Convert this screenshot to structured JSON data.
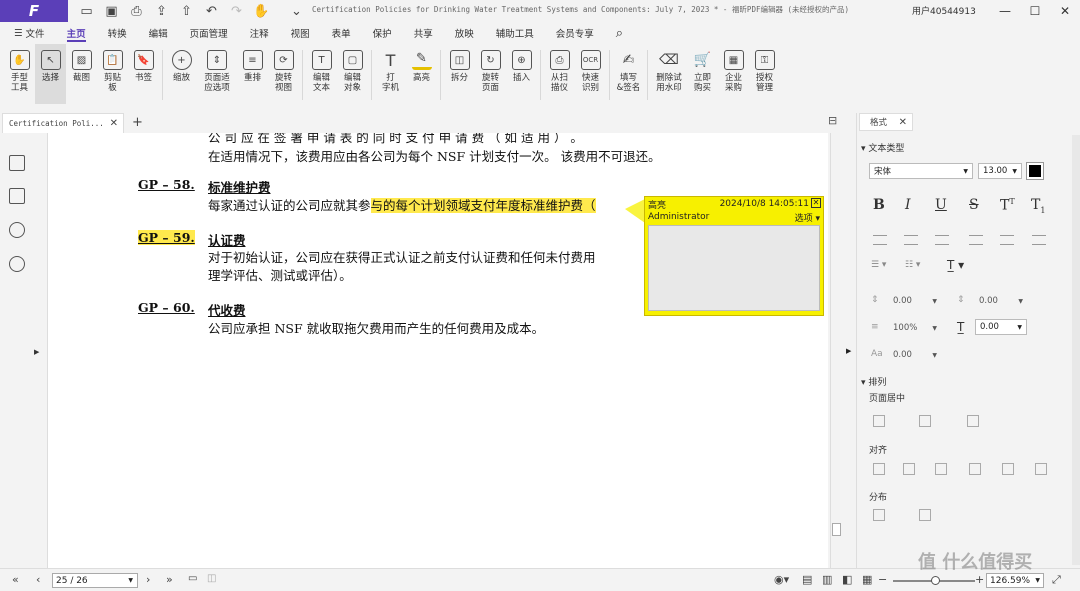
{
  "app": {
    "logo": "F",
    "doc_title": "Certification Policies for Drinking Water Treatment Systems and Components: July 7, 2023 * - 福昕PDF编辑器 (未经授权的产品)",
    "user": "用户40544913"
  },
  "menu": {
    "file": "文件",
    "tabs": [
      "主页",
      "转换",
      "编辑",
      "页面管理",
      "注释",
      "视图",
      "表单",
      "保护",
      "共享",
      "放映",
      "辅助工具",
      "会员专享"
    ]
  },
  "ribbon": {
    "buttons": [
      {
        "label": "手型\n工具",
        "icon": "hand-icon"
      },
      {
        "label": "选择",
        "icon": "select-icon"
      },
      {
        "label": "截图",
        "icon": "snapshot-icon"
      },
      {
        "label": "剪贴\n板",
        "icon": "clipboard-icon"
      },
      {
        "label": "书签",
        "icon": "bookmark-icon"
      },
      {
        "label": "缩放",
        "icon": "zoom-icon"
      },
      {
        "label": "页面适\n应选项",
        "icon": "fit-page-icon"
      },
      {
        "label": "重排",
        "icon": "reflow-icon"
      },
      {
        "label": "旋转\n视图",
        "icon": "rotate-view-icon"
      },
      {
        "label": "编辑\n文本",
        "icon": "edit-text-icon"
      },
      {
        "label": "编辑\n对象",
        "icon": "edit-object-icon"
      },
      {
        "label": "打\n字机",
        "icon": "typewriter-icon"
      },
      {
        "label": "高亮",
        "icon": "highlight-icon"
      },
      {
        "label": "拆分",
        "icon": "split-icon"
      },
      {
        "label": "旋转\n页面",
        "icon": "rotate-page-icon"
      },
      {
        "label": "插入",
        "icon": "insert-icon"
      },
      {
        "label": "从扫\n描仪",
        "icon": "scanner-icon"
      },
      {
        "label": "快速\n识别",
        "icon": "ocr-icon"
      },
      {
        "label": "填写\n&签名",
        "icon": "sign-icon"
      },
      {
        "label": "删除试\n用水印",
        "icon": "remove-watermark-icon"
      },
      {
        "label": "立即\n购买",
        "icon": "cart-icon"
      },
      {
        "label": "企业\n采购",
        "icon": "enterprise-icon"
      },
      {
        "label": "授权\n管理",
        "icon": "license-icon"
      }
    ]
  },
  "doc_tab": {
    "label": "Certification Poli..."
  },
  "document": {
    "line1": "公 司 应 在 签 署 申 请 表 的 同 时 支 付 申 请 费 （ 如 适 用 ） 。",
    "line2": "在适用情况下，该费用应由各公司为每个 NSF 计划支付一次。 该费用不可退还。",
    "gp58_head": "GP – 58.",
    "gp58_title": "标准维护费",
    "gp58_text_a": "每家通过认证的公司应就其参",
    "gp58_text_b": "与的每个计划领域支付年度标准维护费（",
    "gp59_head": "GP – 59.",
    "gp59_title": "认证费",
    "gp59_line1": "对于初始认证，公司应在获得正式认证之前支付认证费和任何未付费用",
    "gp59_line2": "理学评估、测试或评估）。",
    "gp60_head": "GP – 60.",
    "gp60_title": "代收费",
    "gp60_line1": "公司应承担 NSF 就收取拖欠费用而产生的任何费用及成本。"
  },
  "note": {
    "type": "高亮",
    "date": "2024/10/8 14:05:11",
    "author": "Administrator",
    "options": "选项"
  },
  "panel": {
    "tab": "格式",
    "text_type": "文本类型",
    "font": "宋体",
    "size": "13.00",
    "color": "#000000",
    "spacing": [
      "0.00",
      "0.00",
      "100%",
      "0.00",
      "0.00"
    ],
    "arrange": "排列",
    "page_center": "页面居中",
    "align": "对齐",
    "distribute": "分布"
  },
  "status": {
    "page": "25 / 26",
    "zoom": "126.59%"
  },
  "watermark": "值 什么值得买"
}
